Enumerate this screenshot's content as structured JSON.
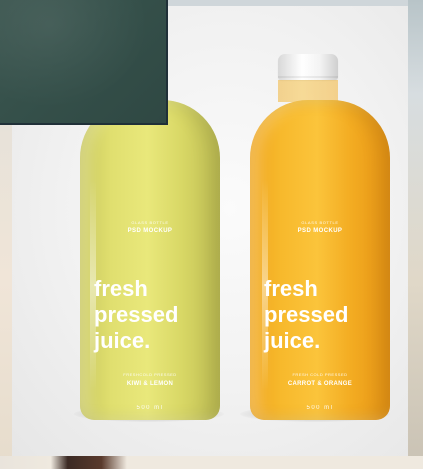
{
  "photo": {
    "subject": "Two juice bottle mockups",
    "bottles": [
      {
        "id": "kiwi",
        "top_small": "GLASS BOTTLE",
        "top_brand": "PSD MOCKUP",
        "headline": [
          "fresh",
          "pressed",
          "juice."
        ],
        "bottom_small": "FRESHCOLD PRESSED",
        "flavour": "KIWI & LEMON",
        "volume": "500 ml",
        "color": "#e3e272"
      },
      {
        "id": "carrot",
        "top_small": "GLASS BOTTLE",
        "top_brand": "PSD MOCKUP",
        "headline": [
          "fresh",
          "pressed",
          "juice."
        ],
        "bottom_small": "FRESH COLD PRESSED",
        "flavour": "CARROT & ORANGE",
        "volume": "500 ml",
        "color": "#f8be34"
      }
    ]
  },
  "colors": {
    "background_frame": "#1f3440",
    "overlay_panel": "#3a5550"
  }
}
